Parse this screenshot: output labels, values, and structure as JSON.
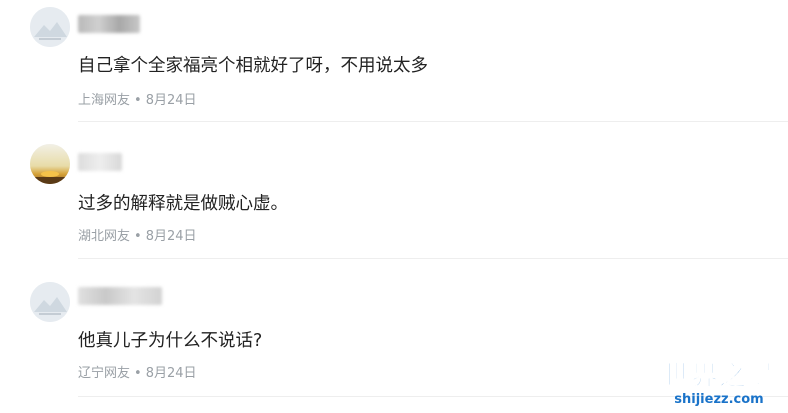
{
  "comments": [
    {
      "text": "自己拿个全家福亮个相就好了呀，不用说太多",
      "location": "上海网友",
      "date": "8月24日",
      "avatar": "default-avatar"
    },
    {
      "text": "过多的解释就是做贼心虚。",
      "location": "湖北网友",
      "date": "8月24日",
      "avatar": "sunset-avatar"
    },
    {
      "text": "他真儿子为什么不说话?",
      "location": "辽宁网友",
      "date": "8月24日",
      "avatar": "default-avatar"
    }
  ],
  "meta_separator": "•",
  "watermark": {
    "title": "世界之最",
    "url": "shijiezz.com"
  },
  "colors": {
    "text": "#222222",
    "meta": "#9aa0a6",
    "watermark": "#1a73c9",
    "divider": "#eeeeee"
  }
}
